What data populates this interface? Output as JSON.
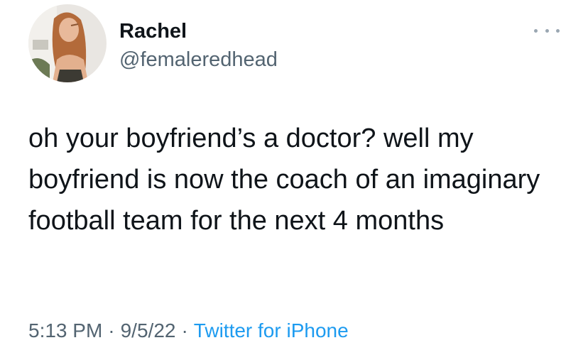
{
  "user": {
    "display_name": "Rachel",
    "handle": "@femaleredhead",
    "avatar": "profile-photo"
  },
  "tweet": {
    "text": "oh your boyfriend’s a doctor? well my boyfriend is now the coach of an imaginary football team for the next 4 months"
  },
  "meta": {
    "time": "5:13 PM",
    "separator": "·",
    "date": "9/5/22",
    "source": "Twitter for iPhone"
  },
  "icons": {
    "more": "more-horizontal-icon"
  },
  "colors": {
    "text": "#0f1419",
    "secondary": "#536471",
    "link": "#1d9bf0"
  }
}
